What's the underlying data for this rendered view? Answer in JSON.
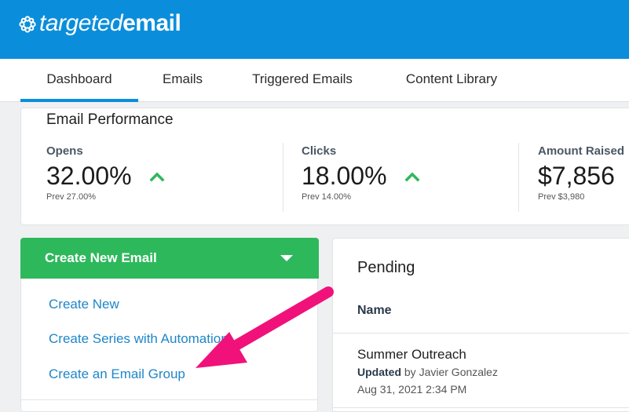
{
  "brand": {
    "logo_light": "targeted",
    "logo_bold": "email",
    "color": "#0a8edb"
  },
  "tabs": [
    {
      "label": "Dashboard",
      "active": true
    },
    {
      "label": "Emails",
      "active": false
    },
    {
      "label": "Triggered Emails",
      "active": false
    },
    {
      "label": "Content Library",
      "active": false
    }
  ],
  "performance": {
    "title": "Email Performance",
    "metrics": [
      {
        "label": "Opens",
        "value": "32.00%",
        "prev": "Prev 27.00%",
        "trend_icon": "chevron-up-icon"
      },
      {
        "label": "Clicks",
        "value": "18.00%",
        "prev": "Prev 14.00%",
        "trend_icon": "chevron-up-icon"
      },
      {
        "label": "Amount Raised",
        "value": "$7,856",
        "prev": "Prev $3,980"
      }
    ],
    "trend_color": "#2eb85c"
  },
  "create_menu": {
    "button_label": "Create New Email",
    "button_color": "#2eb85c",
    "items": [
      "Create New",
      "Create Series with Automation",
      "Create an Email Group"
    ]
  },
  "pending": {
    "title": "Pending",
    "column_name": "Name",
    "rows": [
      {
        "name": "Summer Outreach",
        "updated_label": "Updated",
        "updated_by": " by Javier Gonzalez",
        "date": "Aug 31, 2021 2:34 PM"
      }
    ]
  },
  "annotation": {
    "arrow_color": "#f0127a",
    "points_to": "Create an Email Group"
  }
}
